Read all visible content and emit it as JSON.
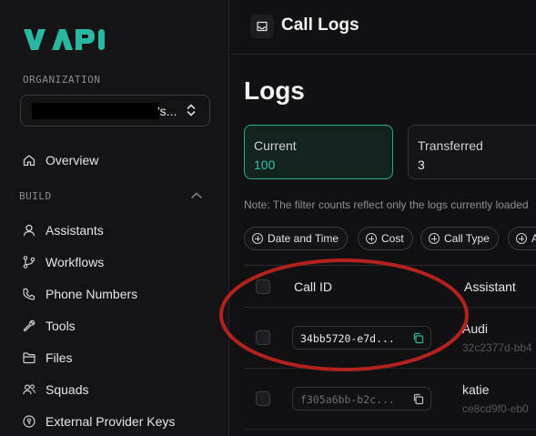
{
  "brand": {
    "logo_text": "VAPI",
    "accent": "#2ab7a0"
  },
  "sidebar": {
    "org_label": "ORGANIZATION",
    "org_suffix": "'s...",
    "overview": "Overview",
    "build_label": "BUILD",
    "items": [
      {
        "label": "Assistants",
        "icon": "user-icon"
      },
      {
        "label": "Workflows",
        "icon": "git-branch-icon"
      },
      {
        "label": "Phone Numbers",
        "icon": "phone-icon"
      },
      {
        "label": "Tools",
        "icon": "wrench-icon"
      },
      {
        "label": "Files",
        "icon": "folder-icon"
      },
      {
        "label": "Squads",
        "icon": "users-icon"
      },
      {
        "label": "External Provider Keys",
        "icon": "key-circle-icon"
      }
    ]
  },
  "header": {
    "title": "Call Logs",
    "icon": "inbox-icon"
  },
  "main": {
    "page_title": "Logs",
    "stats": [
      {
        "label": "Current",
        "value": "100"
      },
      {
        "label": "Transferred",
        "value": "3"
      }
    ],
    "note": "Note: The filter counts reflect only the logs currently loaded",
    "filters": [
      "Date and Time",
      "Cost",
      "Call Type",
      "A"
    ],
    "table": {
      "columns": [
        "Call ID",
        "Assistant"
      ],
      "rows": [
        {
          "call_id": "34bb5720-e7d...",
          "assistant": "Audi",
          "assistant_id": "32c2377d-bb4"
        },
        {
          "call_id": "f305a6bb-b2c...",
          "assistant": "katie",
          "assistant_id": "ce8cd9f0-eb0"
        }
      ]
    }
  },
  "colors": {
    "annotation_ellipse": "#b3221e",
    "current_border": "#2aa98f"
  }
}
